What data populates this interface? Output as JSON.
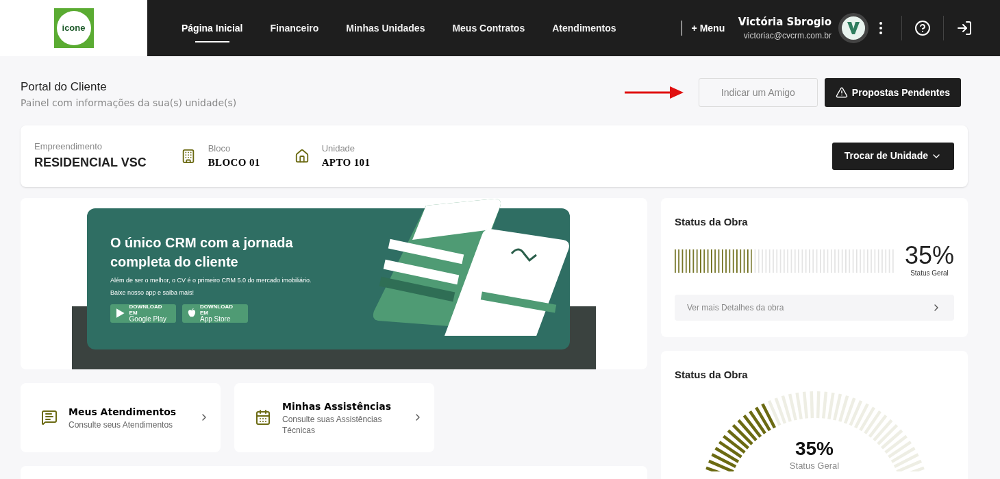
{
  "nav": {
    "items": [
      {
        "label": "Página Inicial",
        "selected": true
      },
      {
        "label": "Financeiro",
        "selected": false
      },
      {
        "label": "Minhas Unidades",
        "selected": false
      },
      {
        "label": "Meus Contratos",
        "selected": false
      },
      {
        "label": "Atendimentos",
        "selected": false
      }
    ],
    "more": "+ Menu",
    "user": {
      "name": "Victória Sbrogio",
      "email": "victoriac@cvcrm.com.br"
    },
    "logo": "icone"
  },
  "header": {
    "title": "Portal do Cliente",
    "subtitle": "Painel com informações da sua(s) unidade(s)",
    "buttons": [
      {
        "label": "Indicar um Amigo",
        "kind": "secondary"
      },
      {
        "label": "Propostas Pendentes",
        "kind": "primary"
      }
    ]
  },
  "unit": {
    "fields": [
      {
        "label": "Empreendimento",
        "value": "RESIDENCIAL VSC",
        "kind": "plain"
      },
      {
        "label": "Bloco",
        "value": "BLOCO 01",
        "kind": "building"
      },
      {
        "label": "Unidade",
        "value": "APTO 101",
        "kind": "house"
      }
    ],
    "switch_button": "Trocar de Unidade"
  },
  "banner": {
    "title": "O único CRM com a jornada completa do cliente",
    "text": "Além de ser o melhor, o CV é o primeiro CRM 5.0 do mercado imobiliário. Baixe nosso app e saiba mais!",
    "stores": [
      {
        "kind": "google",
        "small": "DOWNLOAD EM",
        "name": "Google Play"
      },
      {
        "kind": "apple",
        "small": "DOWNLOAD EM",
        "name": "App Store"
      }
    ]
  },
  "shortcuts": [
    {
      "title": "Meus Atendimentos",
      "subtitle": "Consulte seus Atendimentos",
      "kind": "chat"
    },
    {
      "title": "Minhas Assistências",
      "subtitle": "Consulte suas Assistências Técnicas",
      "kind": "calendar"
    }
  ],
  "status_cards": [
    {
      "title": "Status da Obra",
      "kind": "bars",
      "level": 0.35,
      "percent": "35%",
      "caption": "Status Geral",
      "link": "Ver mais Detalhes da obra"
    },
    {
      "title": "Status da Obra",
      "kind": "gauge",
      "level": 0.35,
      "percent": "35%",
      "caption": "Status Geral"
    }
  ]
}
